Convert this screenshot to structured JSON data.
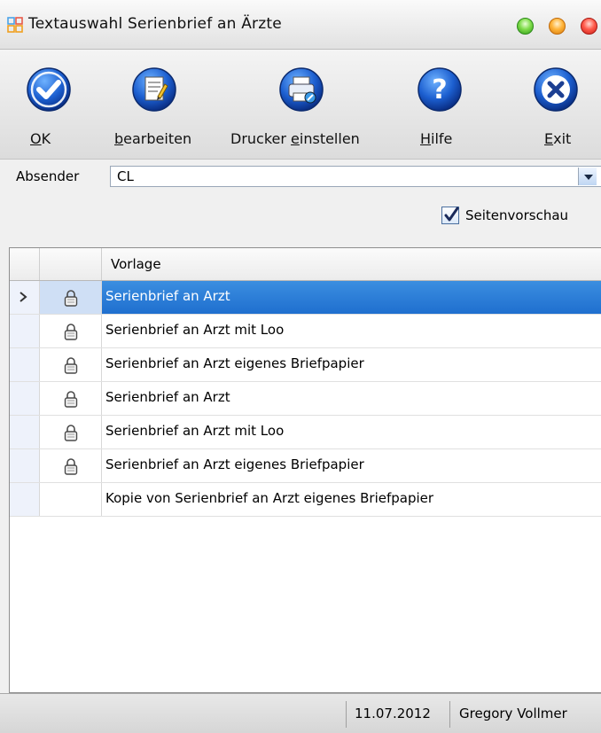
{
  "window": {
    "title": "Textauswahl Serienbrief an Ärzte",
    "icon": "grid-app-icon"
  },
  "toolbar": {
    "buttons": [
      {
        "label": "OK",
        "icon": "checkmark-icon",
        "mnemonic": "O"
      },
      {
        "label": "bearbeiten",
        "icon": "edit-document-icon",
        "mnemonic": "b"
      },
      {
        "label": "Drucker einstellen",
        "icon": "printer-settings-icon",
        "mnemonic": "e"
      },
      {
        "label": "Hilfe",
        "icon": "help-icon",
        "mnemonic": "H"
      },
      {
        "label": "Exit",
        "icon": "close-icon",
        "mnemonic": "E"
      }
    ]
  },
  "sender": {
    "label": "Absender",
    "value": "CL"
  },
  "preview": {
    "label": "Seitenvorschau",
    "checked": true
  },
  "grid": {
    "column_header": "Vorlage",
    "rows": [
      {
        "name": "Serienbrief an Arzt",
        "locked": true,
        "selected": true
      },
      {
        "name": "Serienbrief an Arzt mit Loo",
        "locked": true,
        "selected": false
      },
      {
        "name": "Serienbrief an Arzt eigenes Briefpapier",
        "locked": true,
        "selected": false
      },
      {
        "name": "Serienbrief an Arzt",
        "locked": true,
        "selected": false
      },
      {
        "name": "Serienbrief an Arzt mit Loo",
        "locked": true,
        "selected": false
      },
      {
        "name": "Serienbrief an Arzt eigenes Briefpapier",
        "locked": true,
        "selected": false
      },
      {
        "name": "Kopie von Serienbrief an Arzt eigenes Briefpapier",
        "locked": false,
        "selected": false
      }
    ]
  },
  "status": {
    "date": "11.07.2012",
    "user": "Gregory Vollmer"
  },
  "colors": {
    "selection": "#1f6fcf",
    "selector_column": "#eef2fb"
  }
}
